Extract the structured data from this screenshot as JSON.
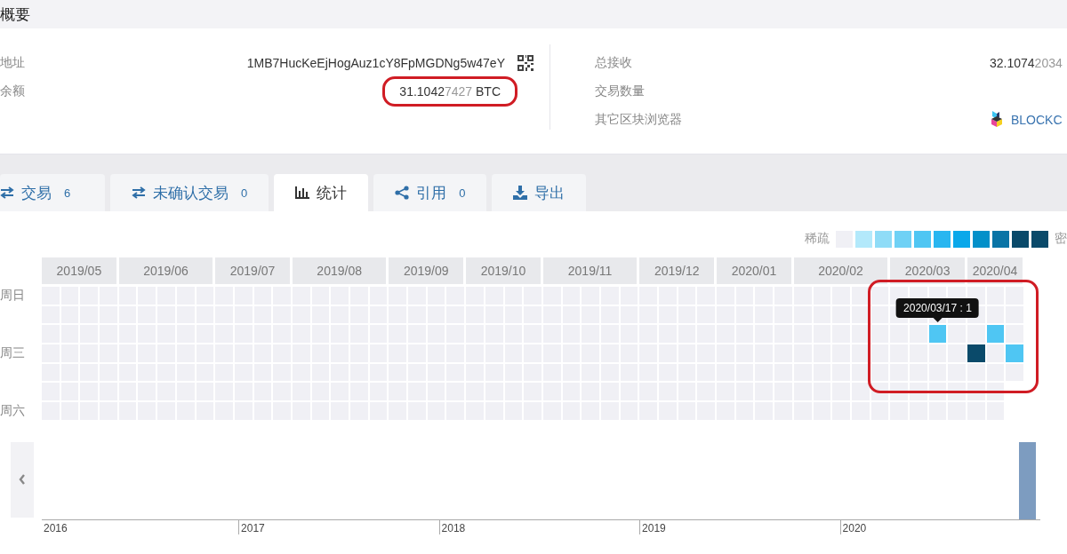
{
  "summary": {
    "title": "概要",
    "left": [
      {
        "kind": "address",
        "label": "地址",
        "value": "1MB7HucKeEjHogAuz1cY8FpMGDNg5w47eY"
      },
      {
        "kind": "amount",
        "label": "余额",
        "main": "31.1042",
        "faded": "7427",
        "unit": "BTC",
        "circled": true
      }
    ],
    "right": [
      {
        "kind": "amount",
        "label": "总接收",
        "main": "32.1074",
        "faded": "2034"
      },
      {
        "kind": "empty",
        "label": "交易数量"
      },
      {
        "kind": "explorer",
        "label": "其它区块浏览器",
        "link": "BLOCKC"
      }
    ]
  },
  "tabs": [
    {
      "kind": "transactions",
      "label": "交易",
      "count": "6",
      "selected": false
    },
    {
      "kind": "unconfirmed",
      "label": "未确认交易",
      "count": "0",
      "selected": false
    },
    {
      "kind": "stats",
      "label": "统计",
      "selected": true
    },
    {
      "kind": "references",
      "label": "引用",
      "count": "0",
      "selected": false
    },
    {
      "kind": "export",
      "label": "导出",
      "selected": false
    }
  ],
  "legend": {
    "low_label": "稀疏",
    "high_label": "密",
    "swatches": [
      {
        "color": "#f0f0f5"
      },
      {
        "color": "#b3e9fb"
      },
      {
        "color": "#8fdcf7"
      },
      {
        "color": "#6fd1f5"
      },
      {
        "color": "#4fc6f3"
      },
      {
        "color": "#29b6f0"
      },
      {
        "color": "#0aa8ea"
      },
      {
        "color": "#0390c9"
      },
      {
        "color": "#0a74a6"
      },
      {
        "color": "#0a4a6a"
      },
      {
        "color": "#0a4a6a"
      }
    ]
  },
  "heatmap": {
    "circled": true,
    "weekdays": [
      {
        "kind": "sunday",
        "label": "周日"
      },
      {
        "kind": "wednesday",
        "label": "周三"
      },
      {
        "kind": "saturday",
        "label": "周六"
      }
    ],
    "months": [
      {
        "label": "2019/05",
        "weeks": [
          {
            "days": [
              {
                "active": false
              },
              {
                "active": false
              },
              {
                "active": false
              },
              {
                "active": false
              },
              {
                "active": false
              },
              {
                "active": false
              },
              {
                "active": false
              }
            ]
          },
          {
            "days": [
              {
                "active": false
              },
              {
                "active": false
              },
              {
                "active": false
              },
              {
                "active": false
              },
              {
                "active": false
              },
              {
                "active": false
              },
              {
                "active": false
              }
            ]
          },
          {
            "days": [
              {
                "active": false
              },
              {
                "active": false
              },
              {
                "active": false
              },
              {
                "active": false
              },
              {
                "active": false
              },
              {
                "active": false
              },
              {
                "active": false
              }
            ]
          },
          {
            "days": [
              {
                "active": false
              },
              {
                "active": false
              },
              {
                "active": false
              },
              {
                "active": false
              },
              {
                "active": false
              },
              {
                "active": false
              },
              {
                "active": false
              }
            ]
          }
        ]
      },
      {
        "label": "2019/06",
        "weeks": [
          {
            "days": [
              {
                "active": false
              },
              {
                "active": false
              },
              {
                "active": false
              },
              {
                "active": false
              },
              {
                "active": false
              },
              {
                "active": false
              },
              {
                "active": false
              }
            ]
          },
          {
            "days": [
              {
                "active": false
              },
              {
                "active": false
              },
              {
                "active": false
              },
              {
                "active": false
              },
              {
                "active": false
              },
              {
                "active": false
              },
              {
                "active": false
              }
            ]
          },
          {
            "days": [
              {
                "active": false
              },
              {
                "active": false
              },
              {
                "active": false
              },
              {
                "active": false
              },
              {
                "active": false
              },
              {
                "active": false
              },
              {
                "active": false
              }
            ]
          },
          {
            "days": [
              {
                "active": false
              },
              {
                "active": false
              },
              {
                "active": false
              },
              {
                "active": false
              },
              {
                "active": false
              },
              {
                "active": false
              },
              {
                "active": false
              }
            ]
          },
          {
            "days": [
              {
                "active": false
              },
              {
                "active": false
              },
              {
                "active": false
              },
              {
                "active": false
              },
              {
                "active": false
              },
              {
                "active": false
              },
              {
                "active": false
              }
            ]
          }
        ]
      },
      {
        "label": "2019/07",
        "weeks": [
          {
            "days": [
              {
                "active": false
              },
              {
                "active": false
              },
              {
                "active": false
              },
              {
                "active": false
              },
              {
                "active": false
              },
              {
                "active": false
              },
              {
                "active": false
              }
            ]
          },
          {
            "days": [
              {
                "active": false
              },
              {
                "active": false
              },
              {
                "active": false
              },
              {
                "active": false
              },
              {
                "active": false
              },
              {
                "active": false
              },
              {
                "active": false
              }
            ]
          },
          {
            "days": [
              {
                "active": false
              },
              {
                "active": false
              },
              {
                "active": false
              },
              {
                "active": false
              },
              {
                "active": false
              },
              {
                "active": false
              },
              {
                "active": false
              }
            ]
          },
          {
            "days": [
              {
                "active": false
              },
              {
                "active": false
              },
              {
                "active": false
              },
              {
                "active": false
              },
              {
                "active": false
              },
              {
                "active": false
              },
              {
                "active": false
              }
            ]
          }
        ]
      },
      {
        "label": "2019/08",
        "weeks": [
          {
            "days": [
              {
                "active": false
              },
              {
                "active": false
              },
              {
                "active": false
              },
              {
                "active": false
              },
              {
                "active": false
              },
              {
                "active": false
              },
              {
                "active": false
              }
            ]
          },
          {
            "days": [
              {
                "active": false
              },
              {
                "active": false
              },
              {
                "active": false
              },
              {
                "active": false
              },
              {
                "active": false
              },
              {
                "active": false
              },
              {
                "active": false
              }
            ]
          },
          {
            "days": [
              {
                "active": false
              },
              {
                "active": false
              },
              {
                "active": false
              },
              {
                "active": false
              },
              {
                "active": false
              },
              {
                "active": false
              },
              {
                "active": false
              }
            ]
          },
          {
            "days": [
              {
                "active": false
              },
              {
                "active": false
              },
              {
                "active": false
              },
              {
                "active": false
              },
              {
                "active": false
              },
              {
                "active": false
              },
              {
                "active": false
              }
            ]
          },
          {
            "days": [
              {
                "active": false
              },
              {
                "active": false
              },
              {
                "active": false
              },
              {
                "active": false
              },
              {
                "active": false
              },
              {
                "active": false
              },
              {
                "active": false
              }
            ]
          }
        ]
      },
      {
        "label": "2019/09",
        "weeks": [
          {
            "days": [
              {
                "active": false
              },
              {
                "active": false
              },
              {
                "active": false
              },
              {
                "active": false
              },
              {
                "active": false
              },
              {
                "active": false
              },
              {
                "active": false
              }
            ]
          },
          {
            "days": [
              {
                "active": false
              },
              {
                "active": false
              },
              {
                "active": false
              },
              {
                "active": false
              },
              {
                "active": false
              },
              {
                "active": false
              },
              {
                "active": false
              }
            ]
          },
          {
            "days": [
              {
                "active": false
              },
              {
                "active": false
              },
              {
                "active": false
              },
              {
                "active": false
              },
              {
                "active": false
              },
              {
                "active": false
              },
              {
                "active": false
              }
            ]
          },
          {
            "days": [
              {
                "active": false
              },
              {
                "active": false
              },
              {
                "active": false
              },
              {
                "active": false
              },
              {
                "active": false
              },
              {
                "active": false
              },
              {
                "active": false
              }
            ]
          }
        ]
      },
      {
        "label": "2019/10",
        "weeks": [
          {
            "days": [
              {
                "active": false
              },
              {
                "active": false
              },
              {
                "active": false
              },
              {
                "active": false
              },
              {
                "active": false
              },
              {
                "active": false
              },
              {
                "active": false
              }
            ]
          },
          {
            "days": [
              {
                "active": false
              },
              {
                "active": false
              },
              {
                "active": false
              },
              {
                "active": false
              },
              {
                "active": false
              },
              {
                "active": false
              },
              {
                "active": false
              }
            ]
          },
          {
            "days": [
              {
                "active": false
              },
              {
                "active": false
              },
              {
                "active": false
              },
              {
                "active": false
              },
              {
                "active": false
              },
              {
                "active": false
              },
              {
                "active": false
              }
            ]
          },
          {
            "days": [
              {
                "active": false
              },
              {
                "active": false
              },
              {
                "active": false
              },
              {
                "active": false
              },
              {
                "active": false
              },
              {
                "active": false
              },
              {
                "active": false
              }
            ]
          }
        ]
      },
      {
        "label": "2019/11",
        "weeks": [
          {
            "days": [
              {
                "active": false
              },
              {
                "active": false
              },
              {
                "active": false
              },
              {
                "active": false
              },
              {
                "active": false
              },
              {
                "active": false
              },
              {
                "active": false
              }
            ]
          },
          {
            "days": [
              {
                "active": false
              },
              {
                "active": false
              },
              {
                "active": false
              },
              {
                "active": false
              },
              {
                "active": false
              },
              {
                "active": false
              },
              {
                "active": false
              }
            ]
          },
          {
            "days": [
              {
                "active": false
              },
              {
                "active": false
              },
              {
                "active": false
              },
              {
                "active": false
              },
              {
                "active": false
              },
              {
                "active": false
              },
              {
                "active": false
              }
            ]
          },
          {
            "days": [
              {
                "active": false
              },
              {
                "active": false
              },
              {
                "active": false
              },
              {
                "active": false
              },
              {
                "active": false
              },
              {
                "active": false
              },
              {
                "active": false
              }
            ]
          },
          {
            "days": [
              {
                "active": false
              },
              {
                "active": false
              },
              {
                "active": false
              },
              {
                "active": false
              },
              {
                "active": false
              },
              {
                "active": false
              },
              {
                "active": false
              }
            ]
          }
        ]
      },
      {
        "label": "2019/12",
        "weeks": [
          {
            "days": [
              {
                "active": false
              },
              {
                "active": false
              },
              {
                "active": false
              },
              {
                "active": false
              },
              {
                "active": false
              },
              {
                "active": false
              },
              {
                "active": false
              }
            ]
          },
          {
            "days": [
              {
                "active": false
              },
              {
                "active": false
              },
              {
                "active": false
              },
              {
                "active": false
              },
              {
                "active": false
              },
              {
                "active": false
              },
              {
                "active": false
              }
            ]
          },
          {
            "days": [
              {
                "active": false
              },
              {
                "active": false
              },
              {
                "active": false
              },
              {
                "active": false
              },
              {
                "active": false
              },
              {
                "active": false
              },
              {
                "active": false
              }
            ]
          },
          {
            "days": [
              {
                "active": false
              },
              {
                "active": false
              },
              {
                "active": false
              },
              {
                "active": false
              },
              {
                "active": false
              },
              {
                "active": false
              },
              {
                "active": false
              }
            ]
          }
        ]
      },
      {
        "label": "2020/01",
        "weeks": [
          {
            "days": [
              {
                "active": false
              },
              {
                "active": false
              },
              {
                "active": false
              },
              {
                "active": false
              },
              {
                "active": false
              },
              {
                "active": false
              },
              {
                "active": false
              }
            ]
          },
          {
            "days": [
              {
                "active": false
              },
              {
                "active": false
              },
              {
                "active": false
              },
              {
                "active": false
              },
              {
                "active": false
              },
              {
                "active": false
              },
              {
                "active": false
              }
            ]
          },
          {
            "days": [
              {
                "active": false
              },
              {
                "active": false
              },
              {
                "active": false
              },
              {
                "active": false
              },
              {
                "active": false
              },
              {
                "active": false
              },
              {
                "active": false
              }
            ]
          },
          {
            "days": [
              {
                "active": false
              },
              {
                "active": false
              },
              {
                "active": false
              },
              {
                "active": false
              },
              {
                "active": false
              },
              {
                "active": false
              },
              {
                "active": false
              }
            ]
          }
        ]
      },
      {
        "label": "2020/02",
        "weeks": [
          {
            "days": [
              {
                "active": false
              },
              {
                "active": false
              },
              {
                "active": false
              },
              {
                "active": false
              },
              {
                "active": false
              },
              {
                "active": false
              },
              {
                "active": false
              }
            ]
          },
          {
            "days": [
              {
                "active": false
              },
              {
                "active": false
              },
              {
                "active": false
              },
              {
                "active": false
              },
              {
                "active": false
              },
              {
                "active": false
              },
              {
                "active": false
              }
            ]
          },
          {
            "days": [
              {
                "active": false
              },
              {
                "active": false
              },
              {
                "active": false
              },
              {
                "active": false
              },
              {
                "active": false
              },
              {
                "active": false
              },
              {
                "active": false
              }
            ]
          },
          {
            "days": [
              {
                "active": false
              },
              {
                "active": false
              },
              {
                "active": false
              },
              {
                "active": false
              },
              {
                "active": false
              },
              {
                "active": false
              },
              {
                "active": false
              }
            ]
          },
          {
            "days": [
              {
                "active": false
              },
              {
                "active": false
              },
              {
                "active": false
              },
              {
                "active": false
              },
              {
                "active": false
              },
              {
                "active": false
              },
              {
                "active": false
              }
            ]
          }
        ]
      },
      {
        "label": "2020/03",
        "weeks": [
          {
            "days": [
              {
                "active": false
              },
              {
                "active": false
              },
              {
                "active": false
              },
              {
                "active": false
              },
              {
                "active": false
              },
              {
                "active": false
              },
              {
                "active": false
              }
            ]
          },
          {
            "days": [
              {
                "active": false
              },
              {
                "active": false
              },
              {
                "active": false
              },
              {
                "active": false
              },
              {
                "active": false
              },
              {
                "active": false
              },
              {
                "active": false
              }
            ]
          },
          {
            "days": [
              {
                "active": false
              },
              {
                "active": false
              },
              {
                "active": true,
                "color": "#4fc6f3",
                "tooltip": "2020/03/17 : 1"
              },
              {
                "active": false
              },
              {
                "active": false
              },
              {
                "active": false
              },
              {
                "active": false
              }
            ]
          },
          {
            "days": [
              {
                "active": false
              },
              {
                "active": false
              },
              {
                "active": false
              },
              {
                "active": false
              },
              {
                "active": false
              },
              {
                "active": false
              },
              {
                "active": false
              }
            ]
          }
        ]
      },
      {
        "label": "2020/04",
        "weeks": [
          {
            "days": [
              {
                "active": false
              },
              {
                "active": false
              },
              {
                "active": false
              },
              {
                "active": true,
                "color": "#0a4a6a"
              },
              {
                "active": false
              },
              {
                "active": false
              },
              {
                "active": false
              }
            ]
          },
          {
            "days": [
              {
                "active": false
              },
              {
                "active": false
              },
              {
                "active": true,
                "color": "#4fc6f3"
              },
              {
                "active": false
              },
              {
                "active": false
              },
              {
                "active": false
              },
              {
                "active": false
              }
            ]
          },
          {
            "days": [
              {
                "active": false
              },
              {
                "active": false
              },
              {
                "active": false
              },
              {
                "active": true,
                "color": "#4fc6f3"
              },
              {
                "active": false
              }
            ]
          }
        ]
      }
    ]
  },
  "timeline": {
    "years": [
      "2016",
      "2017",
      "2018",
      "2019",
      "2020"
    ]
  }
}
